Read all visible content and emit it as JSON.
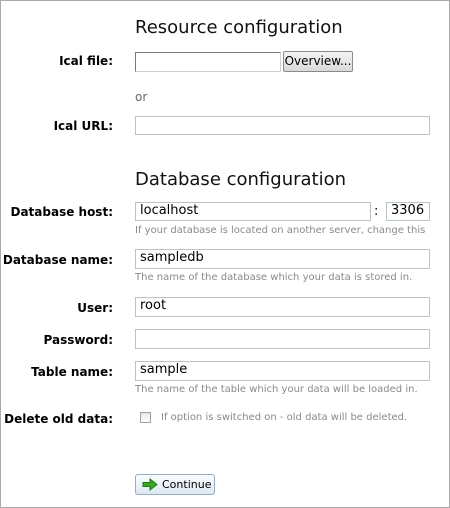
{
  "resource": {
    "heading": "Resource configuration",
    "ical_file_label": "Ical file:",
    "overview_button": "Overview...",
    "or_text": "or",
    "ical_url_label": "Ical URL:"
  },
  "database": {
    "heading": "Database configuration",
    "host_label": "Database host:",
    "host_value": "localhost",
    "port_separator": ":",
    "port_value": "3306",
    "host_hint": "If your database is located on another server, change this",
    "name_label": "Database name:",
    "name_value": "sampledb",
    "name_hint": "The name of the database which your data is stored in.",
    "user_label": "User:",
    "user_value": "root",
    "password_label": "Password:",
    "password_value": "",
    "table_label": "Table name:",
    "table_value": "sample",
    "table_hint": "The name of the table which your data will be loaded in.",
    "delete_label": "Delete old data:",
    "delete_checked": false,
    "delete_hint": "If option is switched on - old data will be deleted."
  },
  "actions": {
    "continue_label": "Continue",
    "continue_icon": "arrow-right-icon",
    "arrow_color": "#2e9a1f"
  }
}
